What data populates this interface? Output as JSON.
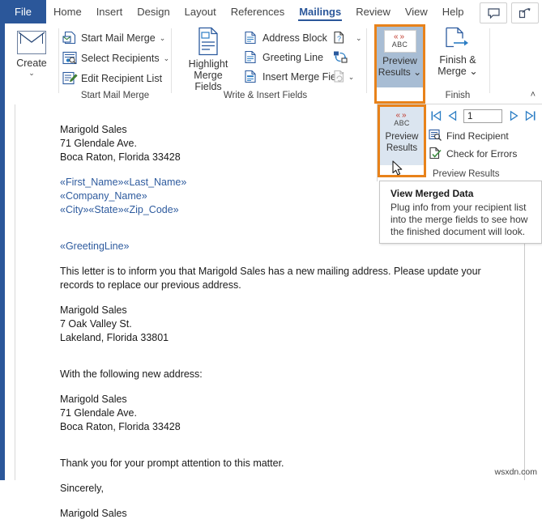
{
  "window": {
    "file_tab": "File",
    "tabs": [
      {
        "label": "Home",
        "active": false
      },
      {
        "label": "Insert",
        "active": false
      },
      {
        "label": "Design",
        "active": false
      },
      {
        "label": "Layout",
        "active": false
      },
      {
        "label": "References",
        "active": false
      },
      {
        "label": "Mailings",
        "active": true
      },
      {
        "label": "Review",
        "active": false
      },
      {
        "label": "View",
        "active": false
      },
      {
        "label": "Help",
        "active": false
      }
    ],
    "comment_icon": "comment-icon",
    "share_icon": "share-icon"
  },
  "ribbon": {
    "create_group": {
      "title": "",
      "button_label": "Create",
      "icon": "envelope-icon",
      "dropdown": "⌄"
    },
    "start_mail_merge_group": {
      "title": "Start Mail Merge",
      "items": [
        {
          "label": "Start Mail Merge",
          "icon": "start-mail-merge-icon",
          "has_dropdown": true
        },
        {
          "label": "Select Recipients",
          "icon": "select-recipients-icon",
          "has_dropdown": true
        },
        {
          "label": "Edit Recipient List",
          "icon": "edit-recipient-list-icon",
          "has_dropdown": false
        }
      ]
    },
    "write_insert_group": {
      "title": "Write & Insert Fields",
      "highlight_label_line1": "Highlight",
      "highlight_label_line2": "Merge Fields",
      "highlight_icon": "highlight-merge-fields-icon",
      "items": [
        {
          "label": "Address Block",
          "icon": "address-block-icon",
          "has_dropdown": false
        },
        {
          "label": "Greeting Line",
          "icon": "greeting-line-icon",
          "has_dropdown": false
        },
        {
          "label": "Insert Merge Field",
          "icon": "insert-merge-field-icon",
          "has_dropdown": true
        }
      ],
      "side_icons": [
        {
          "name": "rules-icon",
          "has_dropdown": true
        },
        {
          "name": "match-fields-icon",
          "has_dropdown": false
        },
        {
          "name": "update-labels-icon",
          "has_dropdown": false
        }
      ]
    },
    "preview_results_group": {
      "title": "",
      "button_label_line1": "Preview",
      "button_label_line2": "Results",
      "icon": "abc-preview-icon",
      "icon_text": "ABC",
      "dropdown": "⌄",
      "highlighted": true,
      "highlight_color": "#e8821a"
    },
    "finish_group": {
      "title": "Finish",
      "button_label_line1": "Finish &",
      "button_label_line2": "Merge",
      "icon": "finish-merge-icon",
      "dropdown": "⌄"
    },
    "collapse_ribbon": "˄"
  },
  "preview_panel": {
    "preview_button_label_line1": "Preview",
    "preview_button_label_line2": "Results",
    "preview_icon_text": "ABC",
    "highlighted": true,
    "nav": {
      "first_icon": "go-to-first-record-icon",
      "previous_icon": "go-to-previous-record-icon",
      "record_number": "1",
      "next_icon": "go-to-next-record-icon",
      "last_icon": "go-to-last-record-icon"
    },
    "items": [
      {
        "label": "Find Recipient",
        "icon": "find-recipient-icon"
      },
      {
        "label": "Check for Errors",
        "icon": "check-for-errors-icon"
      }
    ],
    "group_title": "Preview Results"
  },
  "tooltip": {
    "title": "View Merged Data",
    "body": "Plug info from your recipient list into the merge fields to see how the finished document will look."
  },
  "document": {
    "sender_address": [
      "Marigold Sales",
      "71 Glendale Ave.",
      "Boca Raton, Florida 33428"
    ],
    "merge_fields": [
      "«First_Name»«Last_Name»",
      "«Company_Name»",
      "«City»«State»«Zip_Code»"
    ],
    "greeting_field": "«GreetingLine»",
    "body_paragraph": "This letter is to inform you that Marigold Sales has a new mailing address. Please update your records to replace our previous address.",
    "old_address": [
      "Marigold Sales",
      "7 Oak Valley St.",
      "Lakeland, Florida 33801"
    ],
    "new_address_intro": "With the following new address:",
    "new_address": [
      "Marigold Sales",
      "71 Glendale Ave.",
      "Boca Raton, Florida 33428"
    ],
    "closing_thanks": "Thank you for your prompt attention to this matter.",
    "closing_sincerely": "Sincerely,",
    "signature": "Marigold Sales"
  },
  "watermark": "wsxdn.com"
}
